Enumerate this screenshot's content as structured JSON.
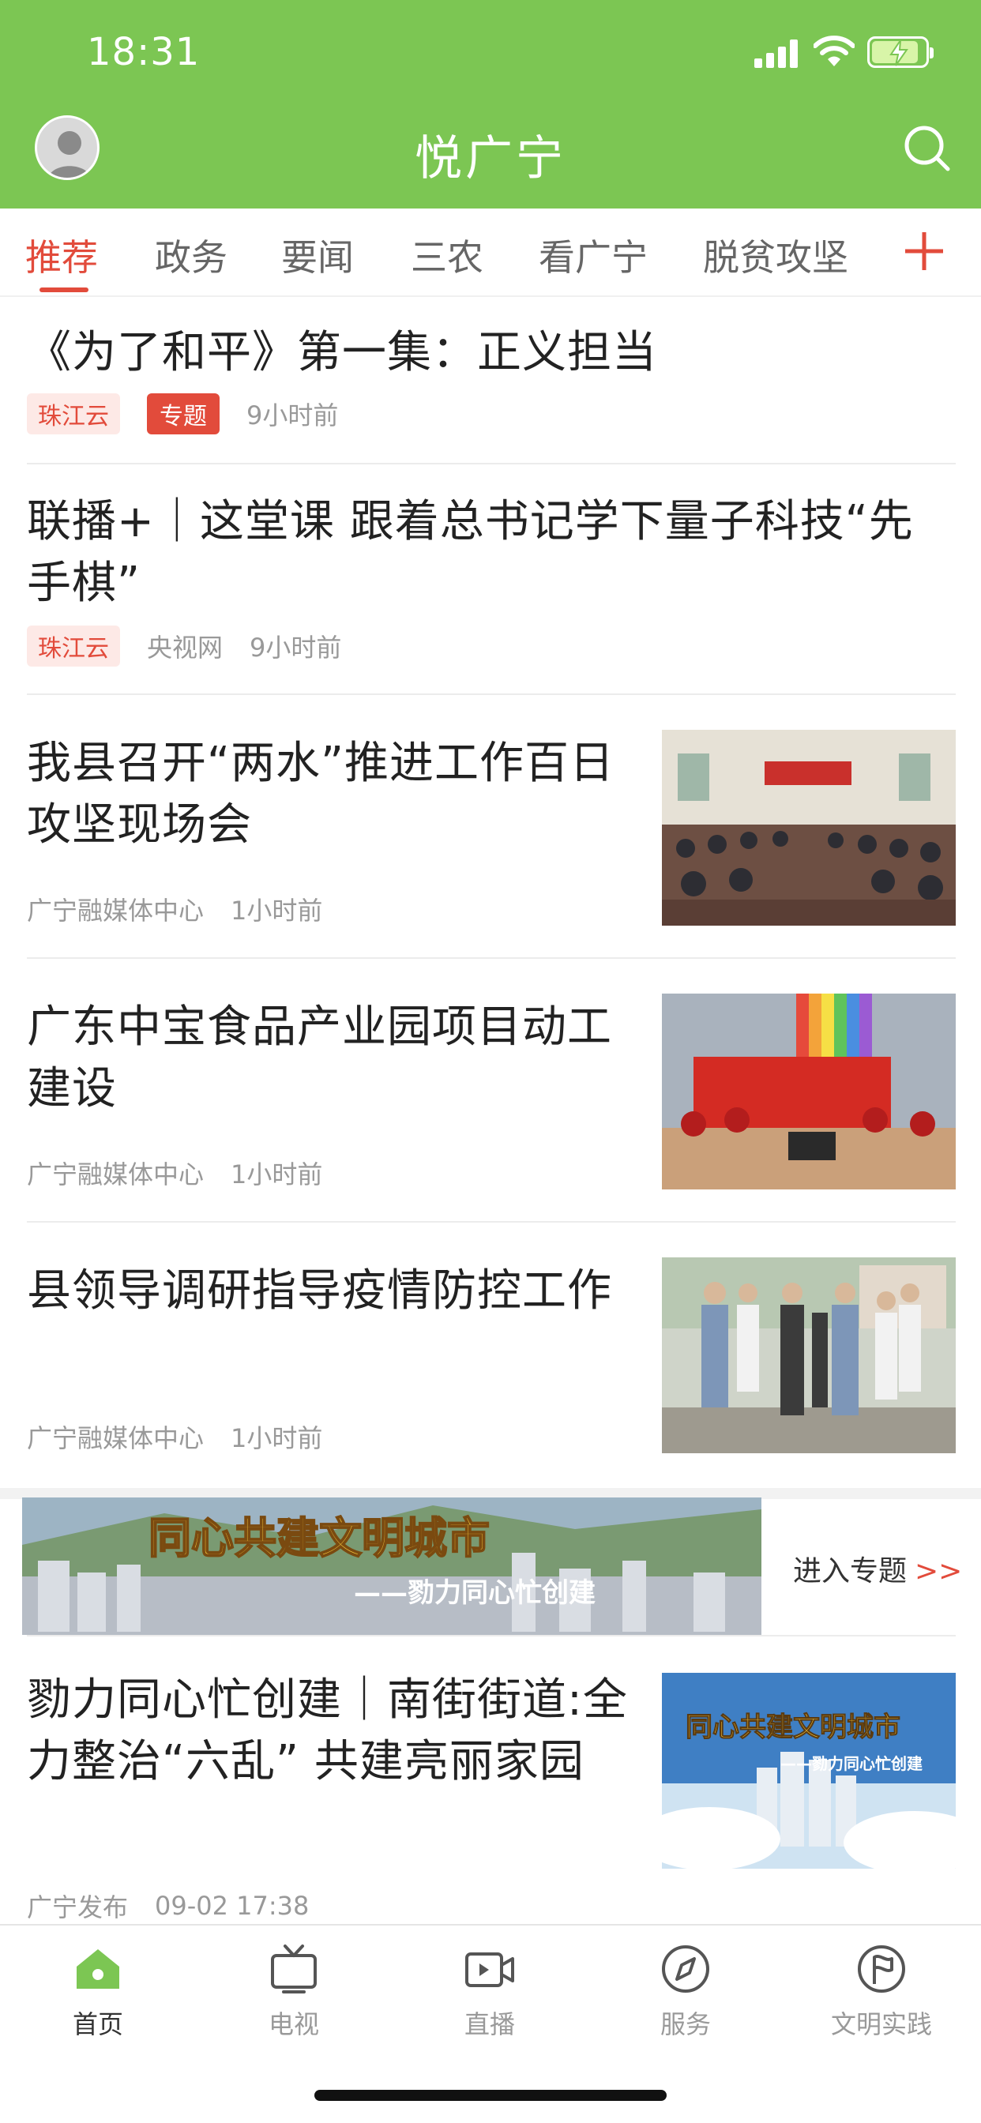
{
  "status_bar": {
    "time": "18:31"
  },
  "header": {
    "title": "悦广宁"
  },
  "tabs": [
    {
      "label": "推荐"
    },
    {
      "label": "政务"
    },
    {
      "label": "要闻"
    },
    {
      "label": "三农"
    },
    {
      "label": "看广宁"
    },
    {
      "label": "脱贫攻坚"
    }
  ],
  "feed": [
    {
      "title": "《为了和平》第一集：正义担当",
      "source_tag": "珠江云",
      "special_tag": "专题",
      "time": "9小时前"
    },
    {
      "title": "联播+｜这堂课 跟着总书记学下量子科技“先手棋”",
      "source_tag": "珠江云",
      "source": "央视网",
      "time": "9小时前"
    },
    {
      "title": "我县召开“两水”推进工作百日攻坚现场会",
      "source": "广宁融媒体中心",
      "time": "1小时前"
    },
    {
      "title": "广东中宝食品产业园项目动工建设",
      "source": "广宁融媒体中心",
      "time": "1小时前"
    },
    {
      "title": "县领导调研指导疫情防控工作",
      "source": "广宁融媒体中心",
      "time": "1小时前"
    }
  ],
  "banner": {
    "headline": "同心共建文明城市",
    "subline": "——勠力同心忙创建",
    "link_label": "进入专题",
    "link_arrows": ">>"
  },
  "feed_after_banner": {
    "title": "勠力同心忙创建｜南街街道:全力整治“六乱” 共建亮丽家园",
    "source": "广宁发布",
    "time": "09-02 17:38",
    "thumb_headline": "同心共建文明城市",
    "thumb_subline": "——勠力同心忙创建"
  },
  "bottom_nav": [
    {
      "label": "首页",
      "icon": "home-icon"
    },
    {
      "label": "电视",
      "icon": "tv-icon"
    },
    {
      "label": "直播",
      "icon": "live-icon"
    },
    {
      "label": "服务",
      "icon": "compass-icon"
    },
    {
      "label": "文明实践",
      "icon": "flag-icon"
    }
  ],
  "colors": {
    "brand_green": "#7cc653",
    "accent_red": "#e24b3b"
  }
}
